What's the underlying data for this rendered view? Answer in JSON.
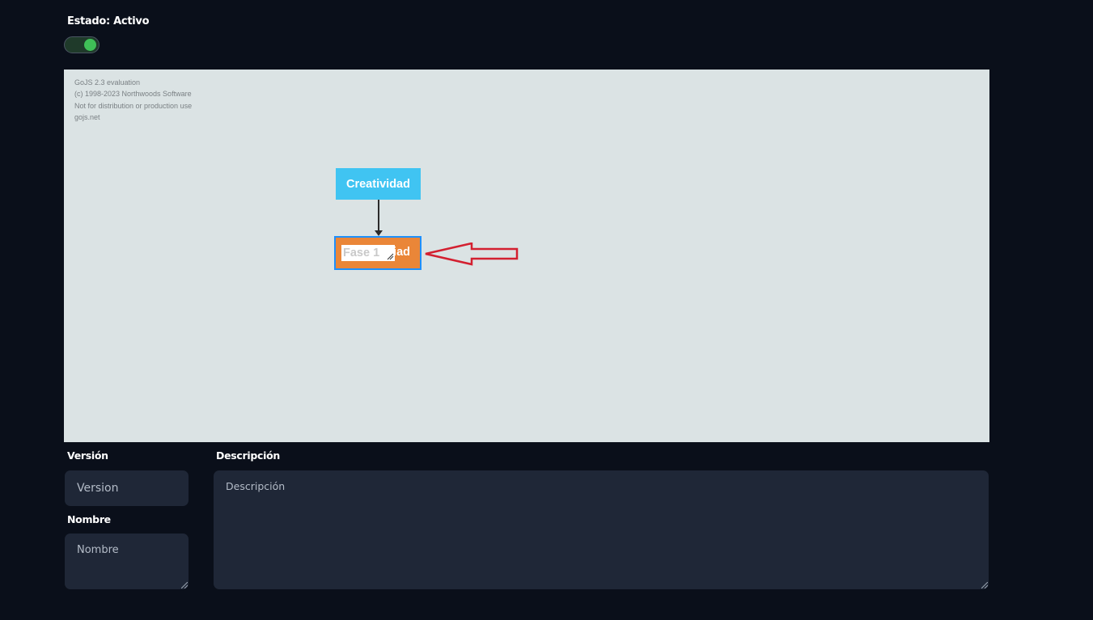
{
  "status": {
    "label": "Estado: Activo",
    "toggle_on": true
  },
  "diagram": {
    "watermark": [
      "GoJS 2.3 evaluation",
      "(c) 1998-2023 Northwoods Software",
      "Not for distribution or production use",
      "gojs.net"
    ],
    "nodes": {
      "creatividad": "Creatividad",
      "fase_text": "iad",
      "fase_editor_value": "Fase 1"
    },
    "colors": {
      "canvas": "#dbe3e4",
      "creatividad_node": "#40c4f2",
      "fase_node": "#ea8638",
      "selection": "#1e90ff",
      "annotation_arrow": "#d32030"
    },
    "icons": {
      "annotation": "red-arrow-left-icon"
    }
  },
  "form": {
    "version": {
      "label": "Versión",
      "placeholder": "Version"
    },
    "nombre": {
      "label": "Nombre",
      "placeholder": "Nombre"
    },
    "descripcion": {
      "label": "Descripción",
      "placeholder": "Descripción"
    }
  }
}
